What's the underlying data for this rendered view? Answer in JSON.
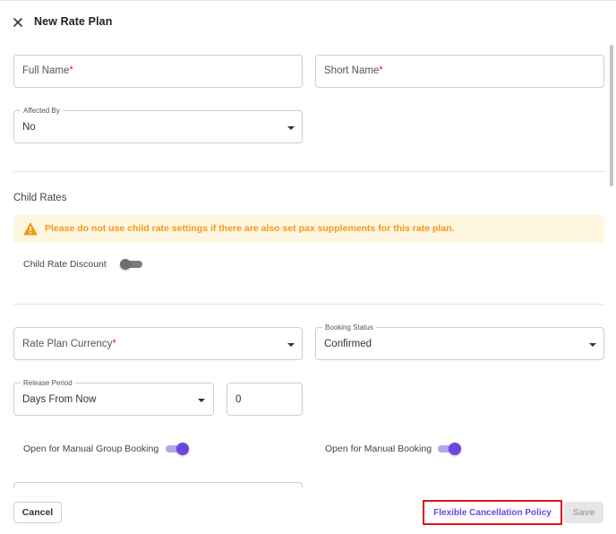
{
  "dialog": {
    "title": "New Rate Plan"
  },
  "form": {
    "full_name": {
      "placeholder": "Full Name",
      "required_mark": "*"
    },
    "short_name": {
      "placeholder": "Short Name",
      "required_mark": "*"
    },
    "affected_by": {
      "legend": "Affected By",
      "value": "No"
    },
    "child_rates": {
      "section_title": "Child Rates",
      "warning_text": "Please do not use child rate settings if there are also set pax supplements for this rate plan.",
      "discount_label": "Child Rate Discount",
      "discount_enabled": false
    },
    "currency": {
      "placeholder": "Rate Plan Currency",
      "required_mark": "*"
    },
    "booking_status": {
      "legend": "Booking Status",
      "value": "Confirmed"
    },
    "release_period": {
      "legend": "Release Period",
      "value": "Days From Now",
      "amount": "0"
    },
    "manual_group_booking": {
      "label": "Open for Manual Group Booking",
      "enabled": true
    },
    "manual_booking": {
      "label": "Open for Manual Booking",
      "enabled": true
    }
  },
  "footer": {
    "cancel_label": "Cancel",
    "policy_label": "Flexible Cancellation Policy",
    "save_label": "Save"
  },
  "colors": {
    "accent": "#6b47dd",
    "warning_text": "#f19a1a",
    "warning_bg": "#fff6e2",
    "required": "#e0282e",
    "highlight_border": "#e01414"
  }
}
